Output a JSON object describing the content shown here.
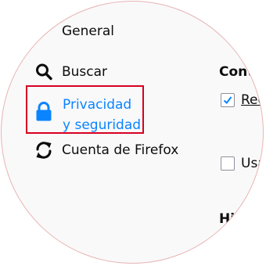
{
  "sidebar": {
    "items": [
      {
        "label": "General",
        "icon": "gear-icon"
      },
      {
        "label": "Buscar",
        "icon": "search-icon"
      },
      {
        "label": "Privacidad y seguridad",
        "icon": "lock-icon",
        "selected": true
      },
      {
        "label": "Cuenta de Firefox",
        "icon": "sync-icon"
      }
    ]
  },
  "content": {
    "section_1_heading": "Cont",
    "checkbox_1": {
      "label": "Rec",
      "checked": true
    },
    "checkbox_2": {
      "label": "Usa",
      "checked": false
    },
    "section_2_heading": "Hi"
  },
  "colors": {
    "selected_text": "#0a84ff",
    "highlight_border": "#d70022",
    "text": "#0c0c0d",
    "check": "#0a84ff",
    "background": "#f9f9fa"
  }
}
